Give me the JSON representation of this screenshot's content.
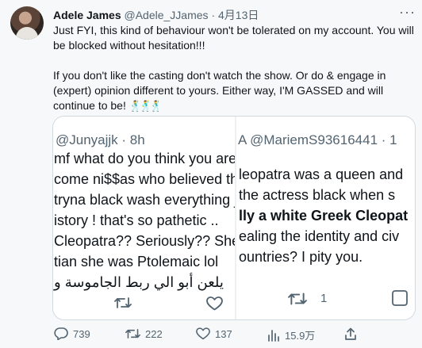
{
  "author": {
    "name": "Adele James",
    "handle": "@Adele_JJames",
    "separator": "·",
    "date": "4月13日",
    "more": "···"
  },
  "tweet": {
    "paragraph1": "Just FYI, this kind of behaviour won't be tolerated on my account. You will be blocked without hesitation!!!",
    "paragraph2": "If you don't like the casting don't watch the show. Or do & engage in (expert) opinion different to yours. Either way, I'M GASSED and will continue to be!",
    "emojis": [
      "dancer-emoji",
      "dancer-emoji",
      "dancer-emoji"
    ]
  },
  "media": {
    "left": {
      "header": "@Junyajjk · 8h",
      "lines": [
        "mf what do you think you are",
        "come ni$$as who believed th",
        "tryna black wash everything j",
        "istory ! that's so pathetic ..",
        "Cleopatra?? Seriously?? She",
        "tian she was Ptolemaic lol",
        "يلعن أبو الي ربط الجاموسة و"
      ]
    },
    "right": {
      "header": "A @MariemS93616441 · 1",
      "lines": [
        "leopatra was a queen and",
        "the actress black when s",
        "lly a white Greek Cleopat",
        "ealing the identity and civ",
        "ountries? I pity you."
      ],
      "retweet_count": "1"
    }
  },
  "actions": {
    "replies": "739",
    "retweets": "222",
    "likes": "137",
    "views": "15.9万"
  },
  "colors": {
    "text": "#0f1419",
    "secondary": "#536471",
    "border": "#cfd9de",
    "background": "#f7f8f9"
  }
}
